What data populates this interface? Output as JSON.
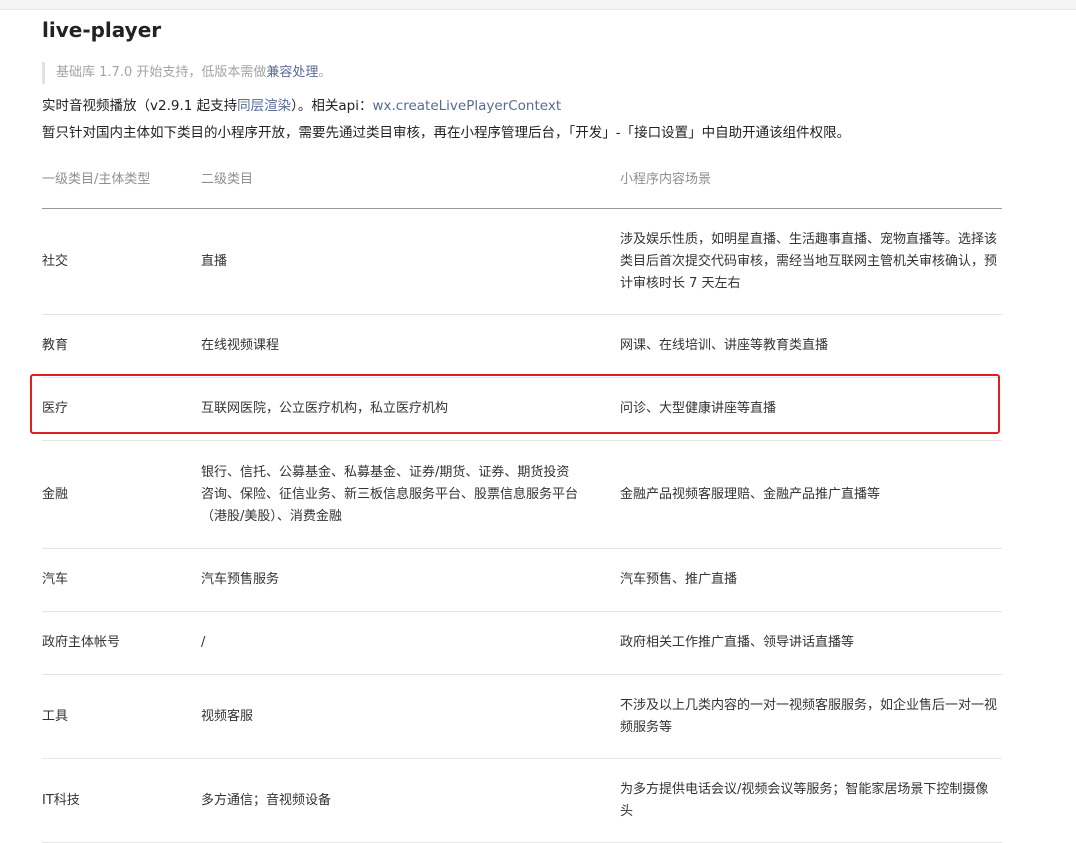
{
  "title": "live-player",
  "note": {
    "prefix": "基础库 1.7.0 开始支持，低版本需做",
    "link": "兼容处理",
    "suffix": "。"
  },
  "description": {
    "part1": "实时音视频播放（v2.9.1 起支持",
    "link1": "同层渲染",
    "part2": "）。相关api：",
    "link2": "wx.createLivePlayerContext"
  },
  "description2": "暂只针对国内主体如下类目的小程序开放，需要先通过类目审核，再在小程序管理后台，「开发」-「接口设置」中自助开通该组件权限。",
  "table": {
    "headers": [
      "一级类目/主体类型",
      "二级类目",
      "小程序内容场景"
    ],
    "rows": [
      [
        "社交",
        "直播",
        "涉及娱乐性质，如明星直播、生活趣事直播、宠物直播等。选择该类目后首次提交代码审核，需经当地互联网主管机关审核确认，预计审核时长 7 天左右"
      ],
      [
        "教育",
        "在线视频课程",
        "网课、在线培训、讲座等教育类直播"
      ],
      [
        "医疗",
        "互联网医院，公立医疗机构，私立医疗机构",
        "问诊、大型健康讲座等直播"
      ],
      [
        "金融",
        "银行、信托、公募基金、私募基金、证券/期货、证券、期货投资咨询、保险、征信业务、新三板信息服务平台、股票信息服务平台（港股/美股）、消费金融",
        "金融产品视频客服理赔、金融产品推广直播等"
      ],
      [
        "汽车",
        "汽车预售服务",
        "汽车预售、推广直播"
      ],
      [
        "政府主体帐号",
        "/",
        "政府相关工作推广直播、领导讲话直播等"
      ],
      [
        "工具",
        "视频客服",
        "不涉及以上几类内容的一对一视频客服服务，如企业售后一对一视频服务等"
      ],
      [
        "IT科技",
        "多方通信；音视频设备",
        "为多方提供电话会议/视频会议等服务；智能家居场景下控制摄像头"
      ]
    ]
  }
}
